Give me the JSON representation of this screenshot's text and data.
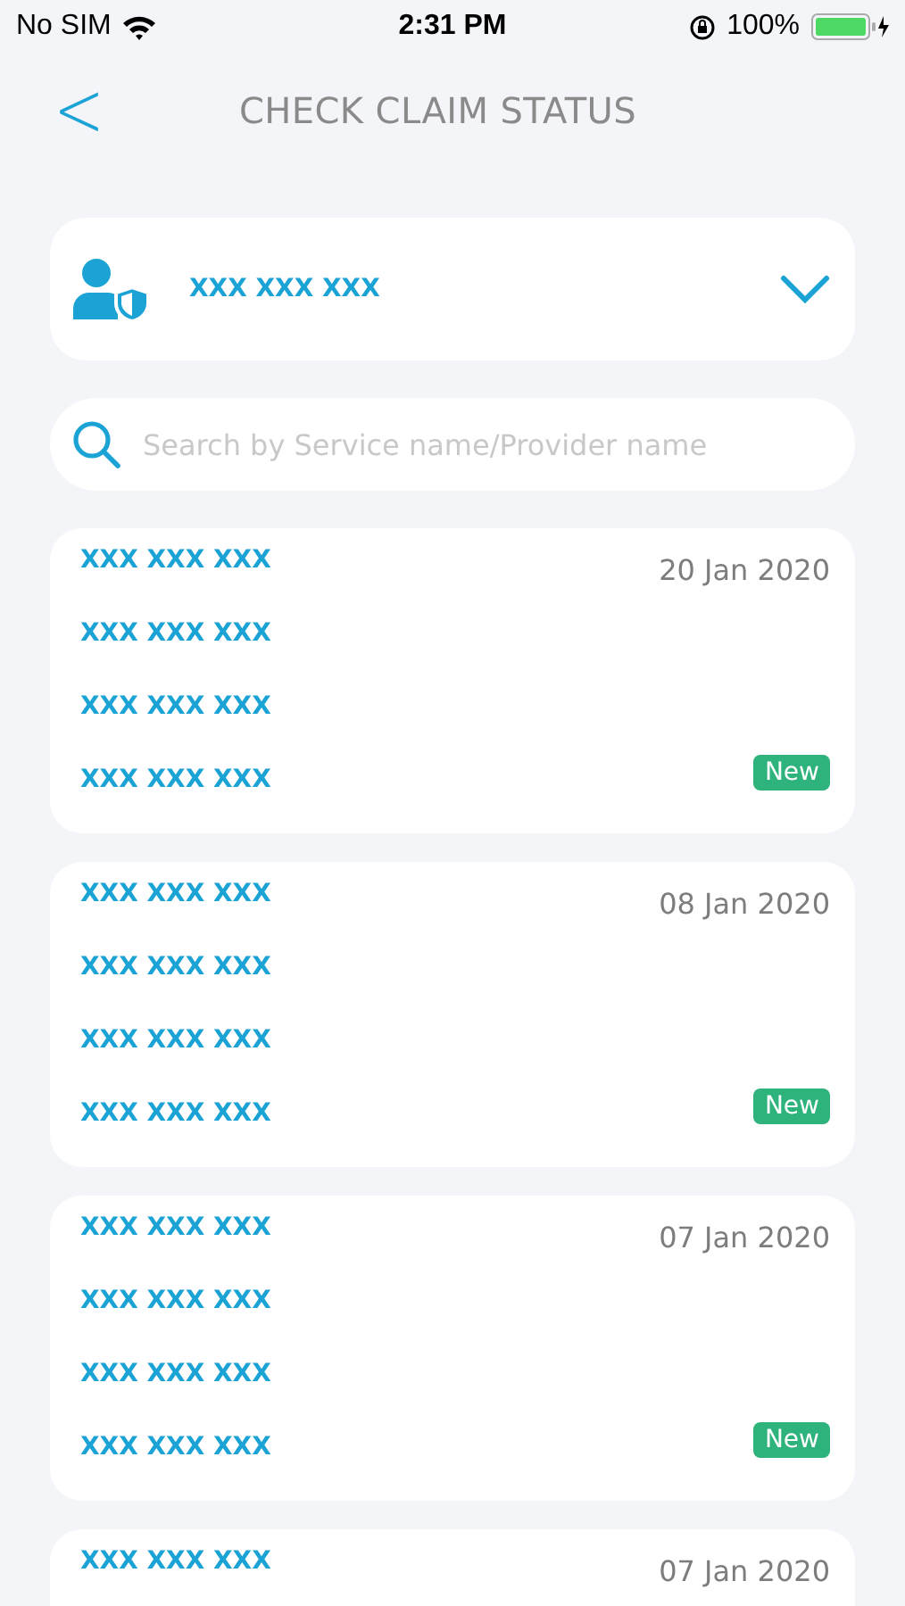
{
  "status_bar": {
    "carrier": "No SIM",
    "time": "2:31 PM",
    "battery": "100%"
  },
  "header": {
    "back": "<",
    "title": "CHECK CLAIM STATUS"
  },
  "member_select": {
    "value": "XXX XXX XXX",
    "expanded": false
  },
  "search": {
    "placeholder": "Search by Service name/Provider name"
  },
  "claims": [
    {
      "lines": [
        "XXX XXX XXX",
        "XXX XXX XXX",
        "XXX XXX XXX",
        "XXX XXX XXX"
      ],
      "date": "20 Jan 2020",
      "status": "New"
    },
    {
      "lines": [
        "XXX XXX XXX",
        "XXX XXX XXX",
        "XXX XXX XXX",
        "XXX XXX XXX"
      ],
      "date": "08 Jan 2020",
      "status": "New"
    },
    {
      "lines": [
        "XXX XXX XXX",
        "XXX XXX XXX",
        "XXX XXX XXX",
        "XXX XXX XXX"
      ],
      "date": "07 Jan 2020",
      "status": "New"
    },
    {
      "lines": [
        "XXX XXX XXX"
      ],
      "date": "07 Jan 2020"
    }
  ]
}
